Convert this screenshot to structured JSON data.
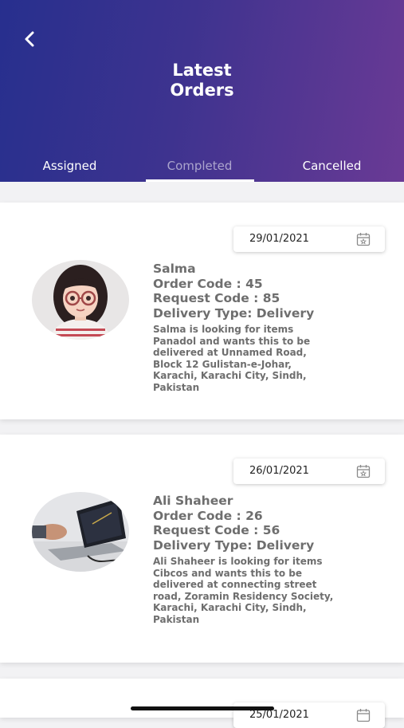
{
  "header": {
    "title_line1": "Latest",
    "title_line2": "Orders",
    "back_icon": "chevron-left-icon"
  },
  "tabs": [
    {
      "label": "Assigned",
      "active": false
    },
    {
      "label": "Completed",
      "active": true
    },
    {
      "label": "Cancelled",
      "active": false
    }
  ],
  "colors": {
    "header_gradient_start": "#272f8e",
    "header_gradient_end": "#6a3a95",
    "text_gray": "#6e6e6e"
  },
  "orders": [
    {
      "date": "29/01/2021",
      "name": "Salma",
      "order_code": "Order Code : 45",
      "request_code": "Request Code : 85",
      "delivery_type": "Delivery Type: Delivery",
      "description": "Salma is looking for items Panadol and wants this to be delivered at Unnamed Road, Block 12 Gulistan-e-Johar, Karachi, Karachi City, Sindh, Pakistan"
    },
    {
      "date": "26/01/2021",
      "name": "Ali Shaheer",
      "order_code": "Order Code : 26",
      "request_code": "Request Code : 56",
      "delivery_type": "Delivery Type: Delivery",
      "description": "Ali Shaheer is looking for items Cibcos and wants this to be delivered at connecting street road, Zoramin Residency Society, Karachi, Karachi City, Sindh, Pakistan"
    },
    {
      "date": "25/01/2021"
    }
  ]
}
